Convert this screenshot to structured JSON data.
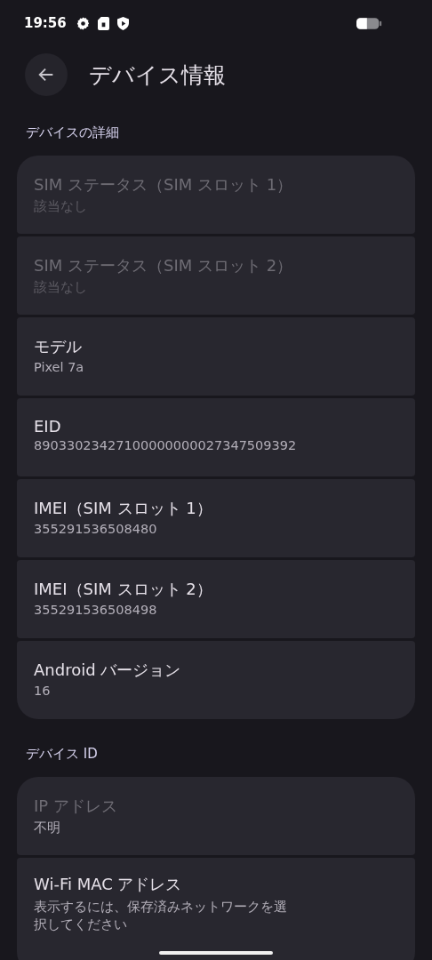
{
  "status_bar": {
    "time": "19:56"
  },
  "header": {
    "title": "デバイス情報"
  },
  "sections": [
    {
      "title": "デバイスの詳細",
      "items": [
        {
          "title": "SIM ステータス（SIM スロット 1）",
          "summary": "該当なし",
          "disabled": true,
          "summary_disabled": true
        },
        {
          "title": "SIM ステータス（SIM スロット 2）",
          "summary": "該当なし",
          "disabled": true,
          "summary_disabled": true
        },
        {
          "title": "モデル",
          "summary": "Pixel 7a",
          "disabled": false,
          "summary_disabled": false
        },
        {
          "title": "EID",
          "summary": "89033023427100000000027347509392",
          "disabled": false,
          "summary_disabled": false
        },
        {
          "title": "IMEI（SIM スロット 1）",
          "summary": "355291536508480",
          "disabled": false,
          "summary_disabled": false
        },
        {
          "title": "IMEI（SIM スロット 2）",
          "summary": "355291536508498",
          "disabled": false,
          "summary_disabled": false
        },
        {
          "title": "Android バージョン",
          "summary": "16",
          "disabled": false,
          "summary_disabled": false
        }
      ]
    },
    {
      "title": "デバイス ID",
      "items": [
        {
          "title": "IP アドレス",
          "summary": "不明",
          "disabled": true,
          "summary_disabled": false
        },
        {
          "title": "Wi-Fi MAC アドレス",
          "summary": "表示するには、保存済みネットワークを選択してください",
          "disabled": false,
          "summary_disabled": false
        }
      ]
    }
  ]
}
